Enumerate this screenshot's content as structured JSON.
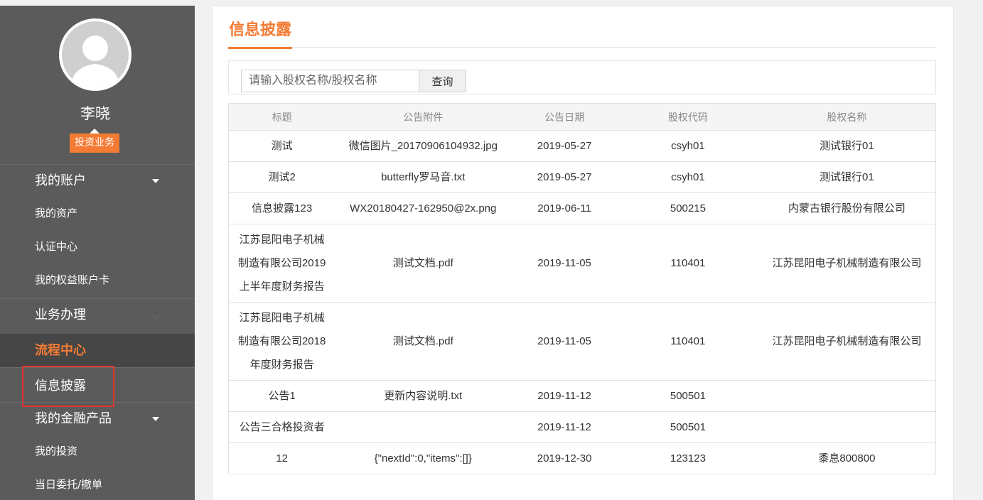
{
  "user": {
    "name": "李晓",
    "role": "投资业务"
  },
  "sidebar": {
    "account_title": "我的账户",
    "account_items": [
      "我的资产",
      "认证中心",
      "我的权益账户卡"
    ],
    "business_title": "业务办理",
    "process_title": "流程中心",
    "info_item": "信息披露",
    "finance_title": "我的金融产品",
    "finance_items": [
      "我的投资",
      "当日委托/撤单"
    ]
  },
  "page": {
    "title": "信息披露"
  },
  "search": {
    "placeholder": "请输入股权名称/股权名称",
    "button": "查询"
  },
  "table": {
    "headers": [
      "标题",
      "公告附件",
      "公告日期",
      "股权代码",
      "股权名称"
    ],
    "rows": [
      [
        "测试",
        "微信图片_20170906104932.jpg",
        "2019-05-27",
        "csyh01",
        "测试银行01"
      ],
      [
        "测试2",
        "butterfly罗马音.txt",
        "2019-05-27",
        "csyh01",
        "测试银行01"
      ],
      [
        "信息披露123",
        "WX20180427-162950@2x.png",
        "2019-06-11",
        "500215",
        "内蒙古银行股份有限公司"
      ],
      [
        "江苏昆阳电子机械制造有限公司2019上半年度财务报告",
        "测试文档.pdf",
        "2019-11-05",
        "110401",
        "江苏昆阳电子机械制造有限公司"
      ],
      [
        "江苏昆阳电子机械制造有限公司2018年度财务报告",
        "测试文档.pdf",
        "2019-11-05",
        "110401",
        "江苏昆阳电子机械制造有限公司"
      ],
      [
        "公告1",
        "更新内容说明.txt",
        "2019-11-12",
        "500501",
        ""
      ],
      [
        "公告三合格投资者",
        "",
        "2019-11-12",
        "500501",
        ""
      ],
      [
        "12",
        "{\"nextId\":0,\"items\":[]}",
        "2019-12-30",
        "123123",
        "黍息800800"
      ]
    ]
  },
  "colors": {
    "accent": "#f47b34",
    "sidebar_bg": "#5b5b5b",
    "highlight": "#e8322d"
  }
}
